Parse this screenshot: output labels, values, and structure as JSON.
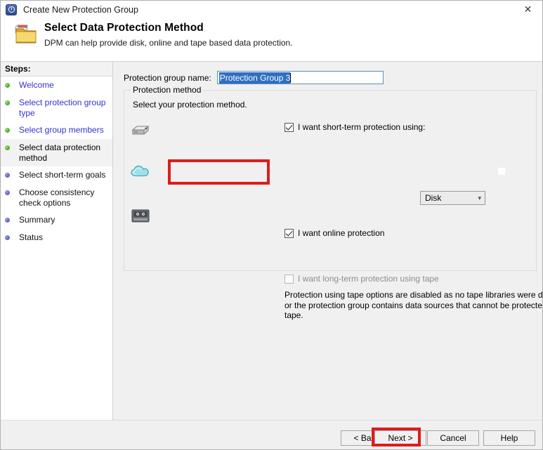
{
  "window": {
    "title": "Create New Protection Group",
    "icon": "clock-recovery-icon",
    "close_label": "✕"
  },
  "header": {
    "title": "Select Data Protection Method",
    "subtitle": "DPM can help provide disk, online and tape based data protection.",
    "icon": "folder-icon"
  },
  "sidebar": {
    "heading": "Steps:",
    "items": [
      {
        "label": "Welcome",
        "state": "done"
      },
      {
        "label": "Select protection group type",
        "state": "done"
      },
      {
        "label": "Select group members",
        "state": "done"
      },
      {
        "label": "Select data protection method",
        "state": "current"
      },
      {
        "label": "Select short-term goals",
        "state": "pending"
      },
      {
        "label": "Choose consistency check options",
        "state": "pending"
      },
      {
        "label": "Summary",
        "state": "pending"
      },
      {
        "label": "Status",
        "state": "pending"
      }
    ]
  },
  "main": {
    "protection_group_name": {
      "label": "Protection group name:",
      "value": "Protection Group 3",
      "selected": true
    },
    "protection_method": {
      "legend": "Protection method",
      "description": "Select your protection method.",
      "short_term": {
        "icon": "disk-drive-icon",
        "label": "I want short-term protection using:",
        "checked": true,
        "enabled": true,
        "combo_value": "Disk",
        "combo_arrow": "⌄"
      },
      "online": {
        "icon": "cloud-icon",
        "label": "I want online protection",
        "checked": true,
        "enabled": true,
        "highlighted": true
      },
      "long_term": {
        "icon": "tape-cartridge-icon",
        "label": "I want long-term protection using tape",
        "checked": false,
        "enabled": false,
        "note": "Protection using tape options are disabled as no tape libraries were detected or the protection group contains data sources that cannot be protected on tape."
      }
    }
  },
  "footer": {
    "back": "< Back",
    "next": "Next >",
    "cancel": "Cancel",
    "help": "Help",
    "next_highlighted": true
  },
  "colors": {
    "annotation": "#e01b1b",
    "link": "#3333cc",
    "selection": "#2f6fc0",
    "step_done": "#3ea11c",
    "step_pending": "#5b5bb8"
  }
}
